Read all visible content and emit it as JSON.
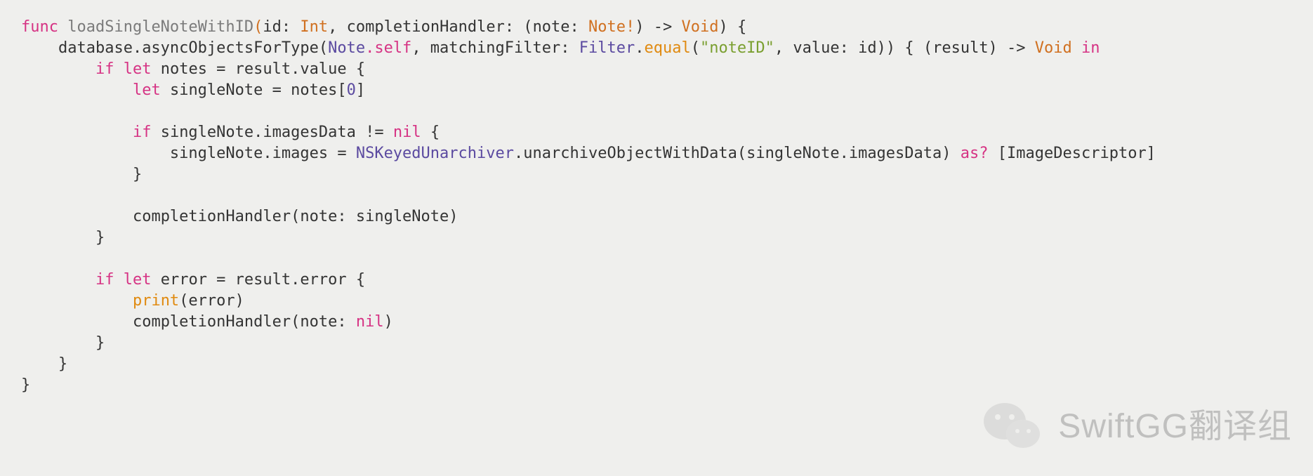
{
  "code": {
    "kw_func": "func",
    "fn_name": "loadSingleNoteWithID",
    "sig_open_paren": "(",
    "param_id_label": "id",
    "colon1": ": ",
    "type_int": "Int",
    "comma1": ", ",
    "param_completion": "completionHandler",
    "colon2": ": (",
    "param_note_label": "note",
    "colon3": ": ",
    "type_note_bang": "Note!",
    "sig_close_arrow": ") -> ",
    "type_void": "Void",
    "sig_close": ") {",
    "line2_left": "database.asyncObjectsForType(",
    "line2_note": "Note",
    "line2_self": ".self",
    "line2_mid": ", matchingFilter: ",
    "line2_filter": "Filter",
    "line2_dot": ".",
    "line2_equal": "equal",
    "line2_open": "(",
    "line2_str": "\"noteID\"",
    "line2_valuearg": ", value: id)) { (result) -> ",
    "line2_void": "Void",
    "line2_in": " in",
    "kw_if": "if",
    "kw_let": "let",
    "line3_rest": " notes = result.value {",
    "line4_singleNote_assign": " singleNote = notes[",
    "num_zero": "0",
    "line4_close": "]",
    "line6_text": " singleNote.imagesData != ",
    "kw_nil": "nil",
    "line6_brace": " {",
    "line7_text": "singleNote.images = ",
    "line7_nsku": "NSKeyedUnarchiver",
    "line7_call": ".unarchiveObjectWithData(singleNote.imagesData) ",
    "kw_asq": "as?",
    "line7_tail": " [ImageDescriptor]",
    "brace_close": "}",
    "line10_text": "completionHandler(note: singleNote)",
    "line13_text": " error = result.error {",
    "call_print": "print",
    "line14_arg": "(error)",
    "line15_text": "completionHandler(note: ",
    "line15_close": ")",
    "indent1": "    ",
    "indent2": "        ",
    "indent3": "            ",
    "indent4": "                ",
    "indent5": "                    "
  },
  "watermark": {
    "text": "SwiftGG翻译组"
  }
}
